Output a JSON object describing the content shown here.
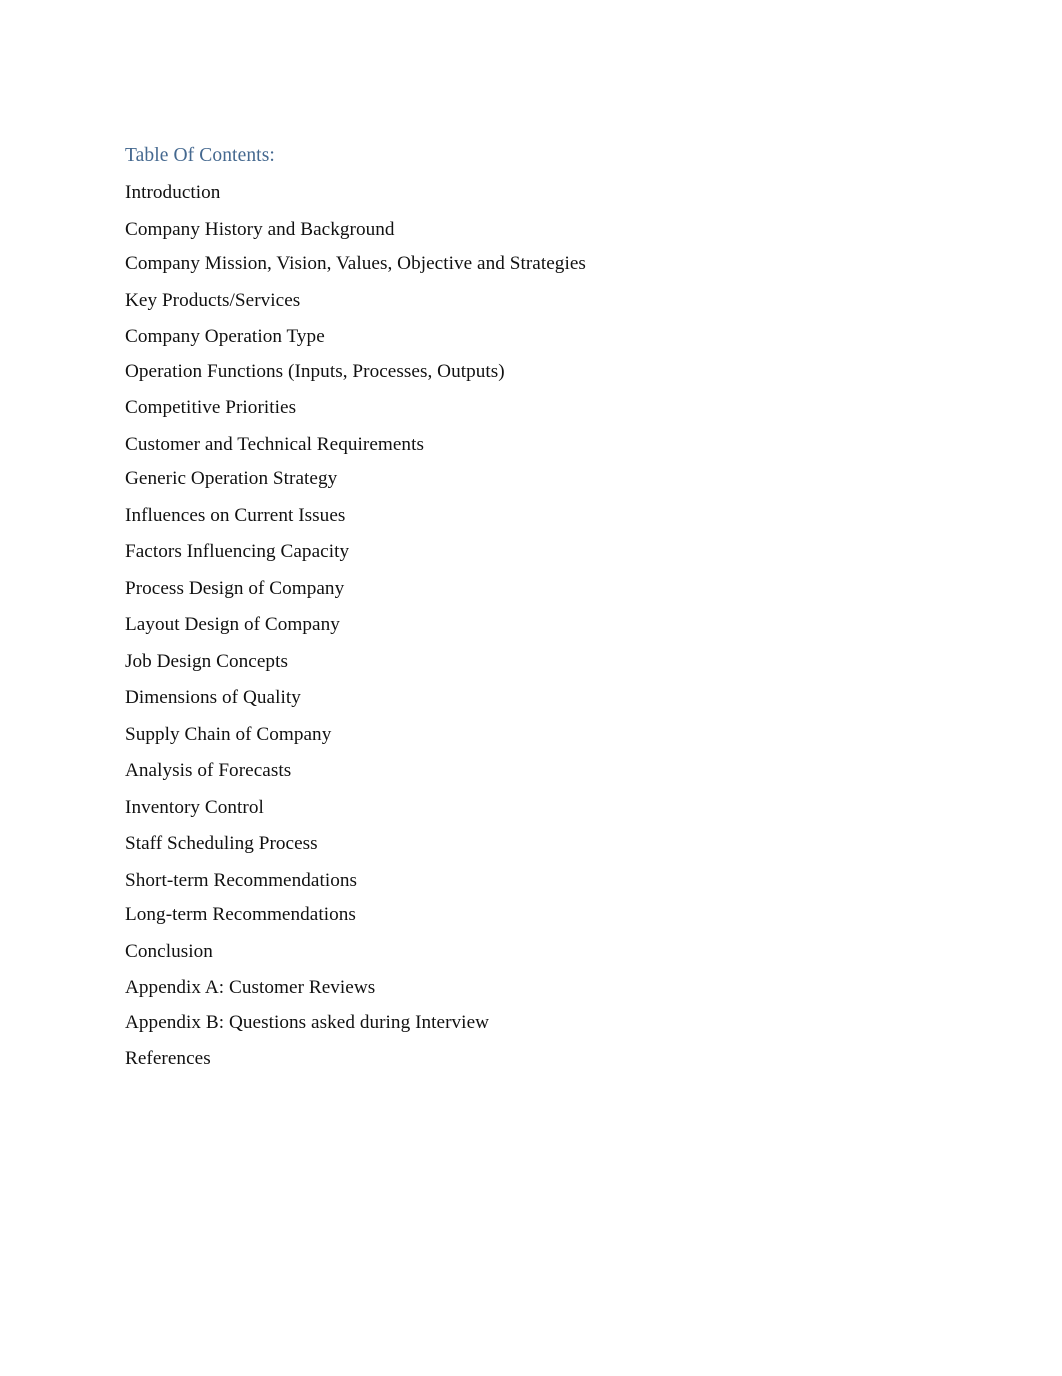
{
  "document": {
    "heading": "Table Of Contents:",
    "heading_color": "#44688f",
    "body_color": "#111111",
    "page_background": "#ffffff"
  },
  "toc": {
    "entries": [
      {
        "label": "Introduction",
        "spacing": "first"
      },
      {
        "label": "Company History and Background",
        "spacing": "normal"
      },
      {
        "label": "Company Mission, Vision, Values, Objective and Strategies",
        "spacing": "tight"
      },
      {
        "label": "Key Products/Services",
        "spacing": "normal"
      },
      {
        "label": "Company Operation Type",
        "spacing": "normal"
      },
      {
        "label": "Operation Functions (Inputs, Processes, Outputs)",
        "spacing": "tight"
      },
      {
        "label": "Competitive Priorities",
        "spacing": "normal"
      },
      {
        "label": "Customer and Technical Requirements",
        "spacing": "normal"
      },
      {
        "label": "Generic Operation Strategy",
        "spacing": "tight"
      },
      {
        "label": "Influences on Current Issues",
        "spacing": "normal"
      },
      {
        "label": "Factors Influencing Capacity",
        "spacing": "normal"
      },
      {
        "label": "Process Design of Company",
        "spacing": "normal"
      },
      {
        "label": "Layout Design of Company",
        "spacing": "normal"
      },
      {
        "label": "Job Design Concepts",
        "spacing": "normal"
      },
      {
        "label": "Dimensions of Quality",
        "spacing": "normal"
      },
      {
        "label": "Supply Chain of Company",
        "spacing": "normal"
      },
      {
        "label": "Analysis of Forecasts",
        "spacing": "normal"
      },
      {
        "label": "Inventory Control",
        "spacing": "normal"
      },
      {
        "label": "Staff Scheduling Process",
        "spacing": "normal"
      },
      {
        "label": "Short-term Recommendations",
        "spacing": "normal"
      },
      {
        "label": "Long-term Recommendations",
        "spacing": "tight"
      },
      {
        "label": "Conclusion",
        "spacing": "normal"
      },
      {
        "label": "Appendix A: Customer Reviews",
        "spacing": "normal"
      },
      {
        "label": "Appendix B: Questions asked during Interview",
        "spacing": "tight"
      },
      {
        "label": "References",
        "spacing": "normal"
      }
    ]
  }
}
